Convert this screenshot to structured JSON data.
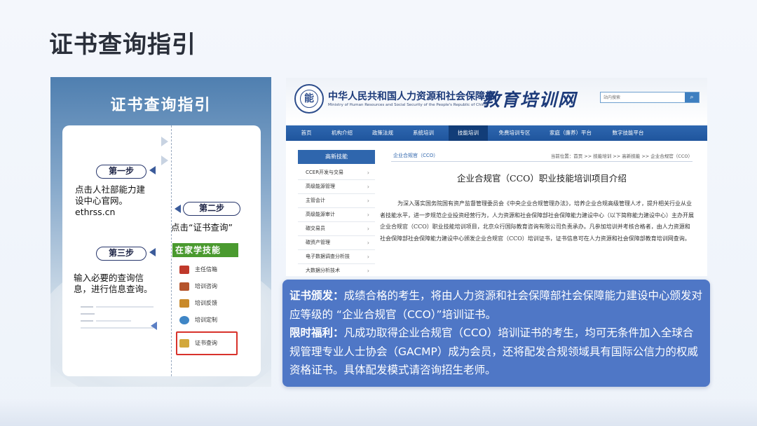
{
  "slide": {
    "title": "证书查询指引"
  },
  "left": {
    "panel_title": "证书查询指引",
    "steps": [
      {
        "label": "第一步",
        "text": [
          "点击人社部能力建",
          "设中心官网。",
          "ethrss.cn"
        ]
      },
      {
        "label": "第二步",
        "text": [
          "点击“证书查询”"
        ]
      },
      {
        "label": "第三步",
        "text": [
          "输入必要的查询信",
          "息，进行信息查询。"
        ]
      }
    ],
    "mini_site": {
      "banner": "在家学技能",
      "items": [
        {
          "label": "主任信箱",
          "icon": "mailbox-icon",
          "color": "#c0392b"
        },
        {
          "label": "培训咨询",
          "icon": "consult-icon",
          "color": "#b5542c"
        },
        {
          "label": "培训反馈",
          "icon": "feedback-icon",
          "color": "#c98a2a"
        },
        {
          "label": "培训定制",
          "icon": "globe-icon",
          "color": "#3f86c6"
        },
        {
          "label": "证书查询",
          "icon": "certificate-icon",
          "color": "#d2a83c"
        }
      ]
    }
  },
  "site": {
    "ministry_cn": "中华人民共和国人力资源和社会保障部",
    "ministry_en": "Ministry of Human Resources and Social Security of the People's Republic of China",
    "logo_text": "教育培训网",
    "search_placeholder": "站内搜索",
    "nav": [
      "首页",
      "机构介绍",
      "政策法规",
      "系统培训",
      "技能培训",
      "免费培训专区",
      "家庭（廉养）平台",
      "数字技能平台"
    ],
    "nav_active": "技能培训",
    "sidebar_title": "高新技能",
    "sidebar": [
      "CCER开发与交易",
      "高级能源管理",
      "主管会计",
      "高级能源审计",
      "碳交易员",
      "碳资产管理",
      "电子数据调查分析技",
      "大数据分析技术"
    ],
    "breadcrumb_category": "企业合规官（CCO）",
    "breadcrumb_path": "当前位置：首页 >> 技能培训 >> 高新技能 >> 企业合规官（CCO）",
    "article_title": "企业合规官（CCO）职业技能培训项目介绍",
    "article_body": "为深入落实国务院国有资产监督管理委员会《中央企业合规管理办法》，培养企业合规高级管理人才，提升相关行业从业者技能水平，进一步规范企业投资经营行为，人力资源和社会保障部社会保障能力建设中心（以下简称能力建设中心）主办开展企业合规官（CCO）职业技能培训项目，北京众行国际教育咨询有限公司负责承办。凡参加培训并考核合格者，由人力资源和社会保障部社会保障能力建设中心颁发企业合规官（CCO）培训证书，证书信息可在人力资源和社会保障部教育培训网查询。"
  },
  "info": {
    "p1_label": "证书颁发：",
    "p1_text": "成绩合格的考生，将由人力资源和社会保障部社会保障能力建设中心颁发对应等级的 “企业合规官（CCO）”培训证书。",
    "p2_label": "限时福利：",
    "p2_text": "凡成功取得企业合规官（CCO）培训证书的考生，均可无条件加入全球合规管理专业人士协会（GACMP）成为会员，还将配发合规领域具有国际公信力的权威资格证书。具体配发模式请咨询招生老师。"
  }
}
